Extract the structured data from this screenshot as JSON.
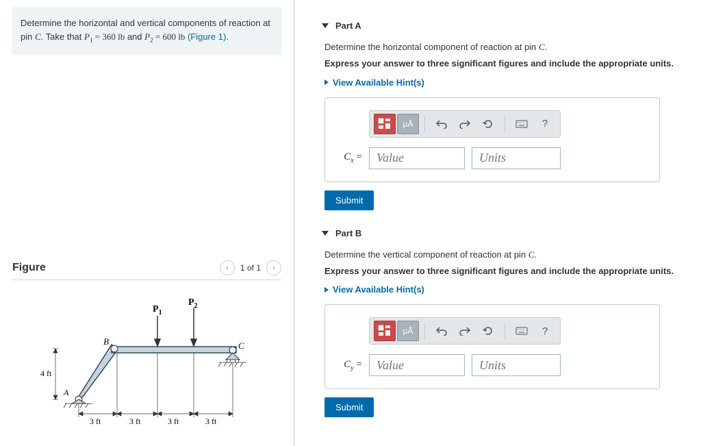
{
  "problem": {
    "text_a": "Determine the horizontal and vertical components of reaction at pin ",
    "pin_var": "C",
    "text_b": ". Take that ",
    "p1_var": "P",
    "p1_sub": "1",
    "p1_val": " = 360 lb",
    "and_text": " and ",
    "p2_var": "P",
    "p2_sub": "2",
    "p2_val": " = 600 lb",
    "figure_ref": " (Figure 1)",
    "period": "."
  },
  "figure": {
    "title": "Figure",
    "page_text": "1 of 1",
    "labels": {
      "P1": "P",
      "P1sub": "1",
      "P2": "P",
      "P2sub": "2",
      "B": "B",
      "C": "C",
      "A": "A",
      "v_dim": "4 ft",
      "h_dim": "3 ft"
    }
  },
  "parts": {
    "A": {
      "title": "Part A",
      "prompt_a": "Determine the horizontal component of reaction at pin ",
      "prompt_var": "C",
      "prompt_b": ".",
      "instruction": "Express your answer to three significant figures and include the appropriate units.",
      "hint": "View Available Hint(s)",
      "var_label_base": "C",
      "var_label_sub": "x",
      "equals": " =",
      "value_ph": "Value",
      "units_ph": "Units",
      "submit": "Submit"
    },
    "B": {
      "title": "Part B",
      "prompt_a": "Determine the vertical component of reaction at pin ",
      "prompt_var": "C",
      "prompt_b": ".",
      "instruction": "Express your answer to three significant figures and include the appropriate units.",
      "hint": "View Available Hint(s)",
      "var_label_base": "C",
      "var_label_sub": "y",
      "equals": " =",
      "value_ph": "Value",
      "units_ph": "Units",
      "submit": "Submit"
    }
  },
  "toolbar": {
    "special_label": "μÅ",
    "help": "?"
  }
}
